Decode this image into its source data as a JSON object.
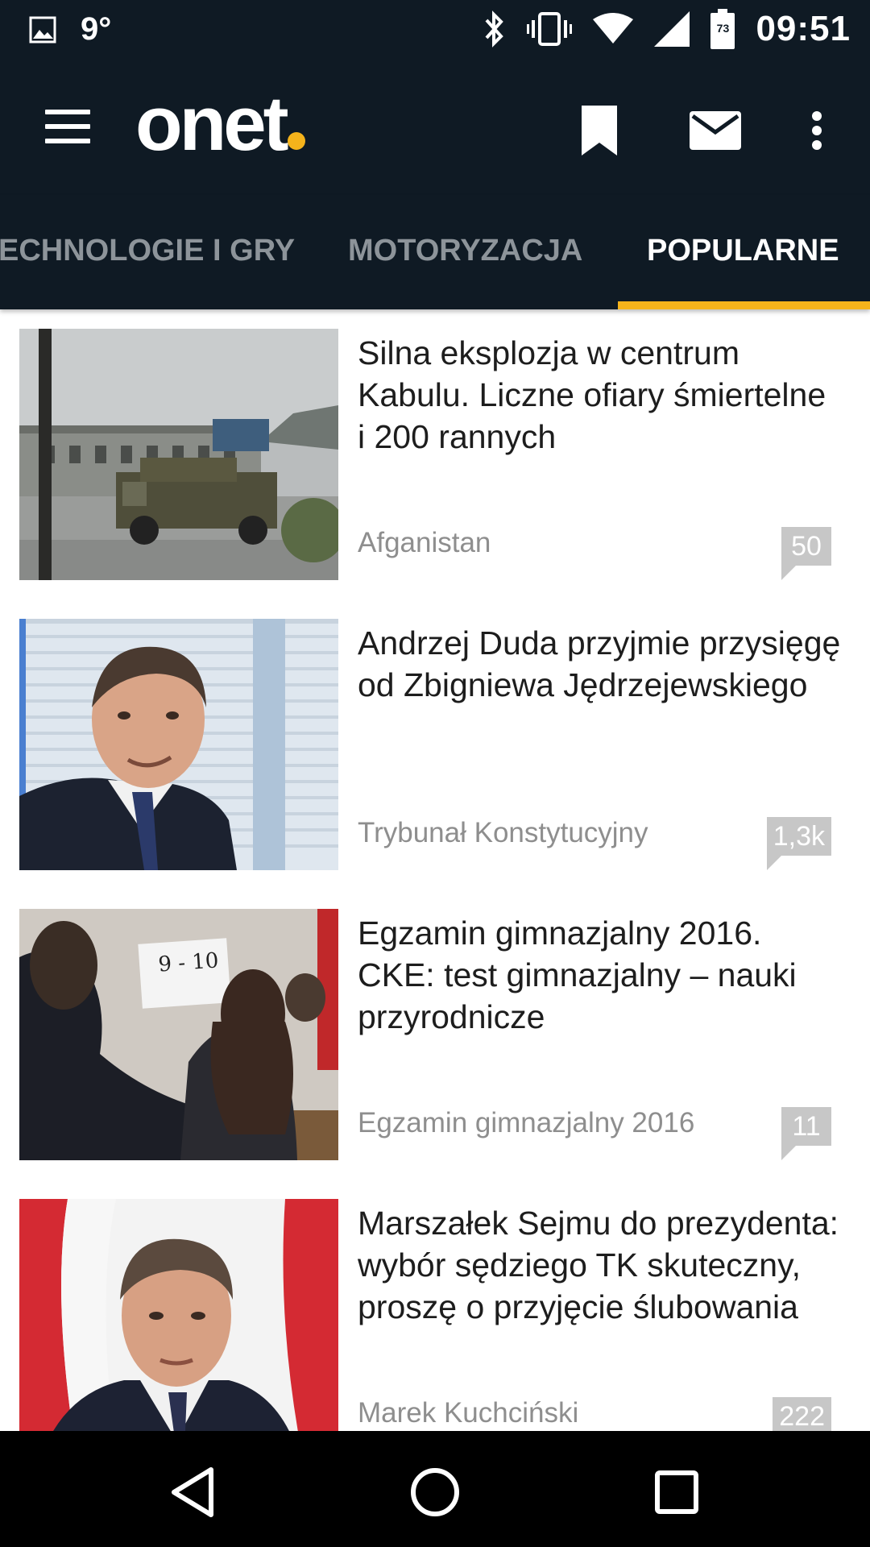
{
  "status_bar": {
    "temperature": "9°",
    "time": "09:51",
    "battery_level": "73",
    "icons": [
      "image-icon",
      "bluetooth-icon",
      "vibrate-icon",
      "wifi-icon",
      "signal-icon",
      "battery-icon"
    ]
  },
  "app_bar": {
    "logo": "onet",
    "actions": [
      "bookmark-icon",
      "mail-icon",
      "more-vert-icon"
    ]
  },
  "tabs": {
    "items": [
      {
        "label": "ECHNOLOGIE I GRY"
      },
      {
        "label": "MOTORYZACJA"
      },
      {
        "label": "POPULARNE"
      }
    ],
    "active_index": 2
  },
  "feed": {
    "items": [
      {
        "headline": "Silna eksplozja w centrum Kabulu. Liczne ofiary śmiertelne i 200 rannych",
        "category": "Afganistan",
        "comments": "50",
        "image": "armored-vehicle-photo"
      },
      {
        "headline": "Andrzej Duda przyjmie przysięgę od Zbigniewa Jędrzejewskiego",
        "category": "Trybunał Konstytucyjny",
        "comments": "1,3k",
        "image": "man-portrait-photo"
      },
      {
        "headline": "Egzamin gimnazjalny 2016. CKE: test gimnazjalny – nauki przyrodnicze",
        "category": "Egzamin gimnazjalny 2016",
        "comments": "11",
        "image": "exam-classroom-photo",
        "sign_text": "9 - 10"
      },
      {
        "headline": "Marszałek Sejmu do prezydenta: wybór sędziego TK skuteczny, proszę o przyjęcie ślubowania",
        "category": "Marek Kuchciński",
        "comments": "222",
        "image": "politician-flags-photo"
      }
    ]
  },
  "nav_bar": {
    "buttons": [
      "back-icon",
      "home-icon",
      "recents-icon"
    ]
  },
  "colors": {
    "bar_background": "#0f1a24",
    "accent": "#f5b31b",
    "inactive_tab": "#8d949a",
    "comment_badge": "#c7c7c7"
  }
}
